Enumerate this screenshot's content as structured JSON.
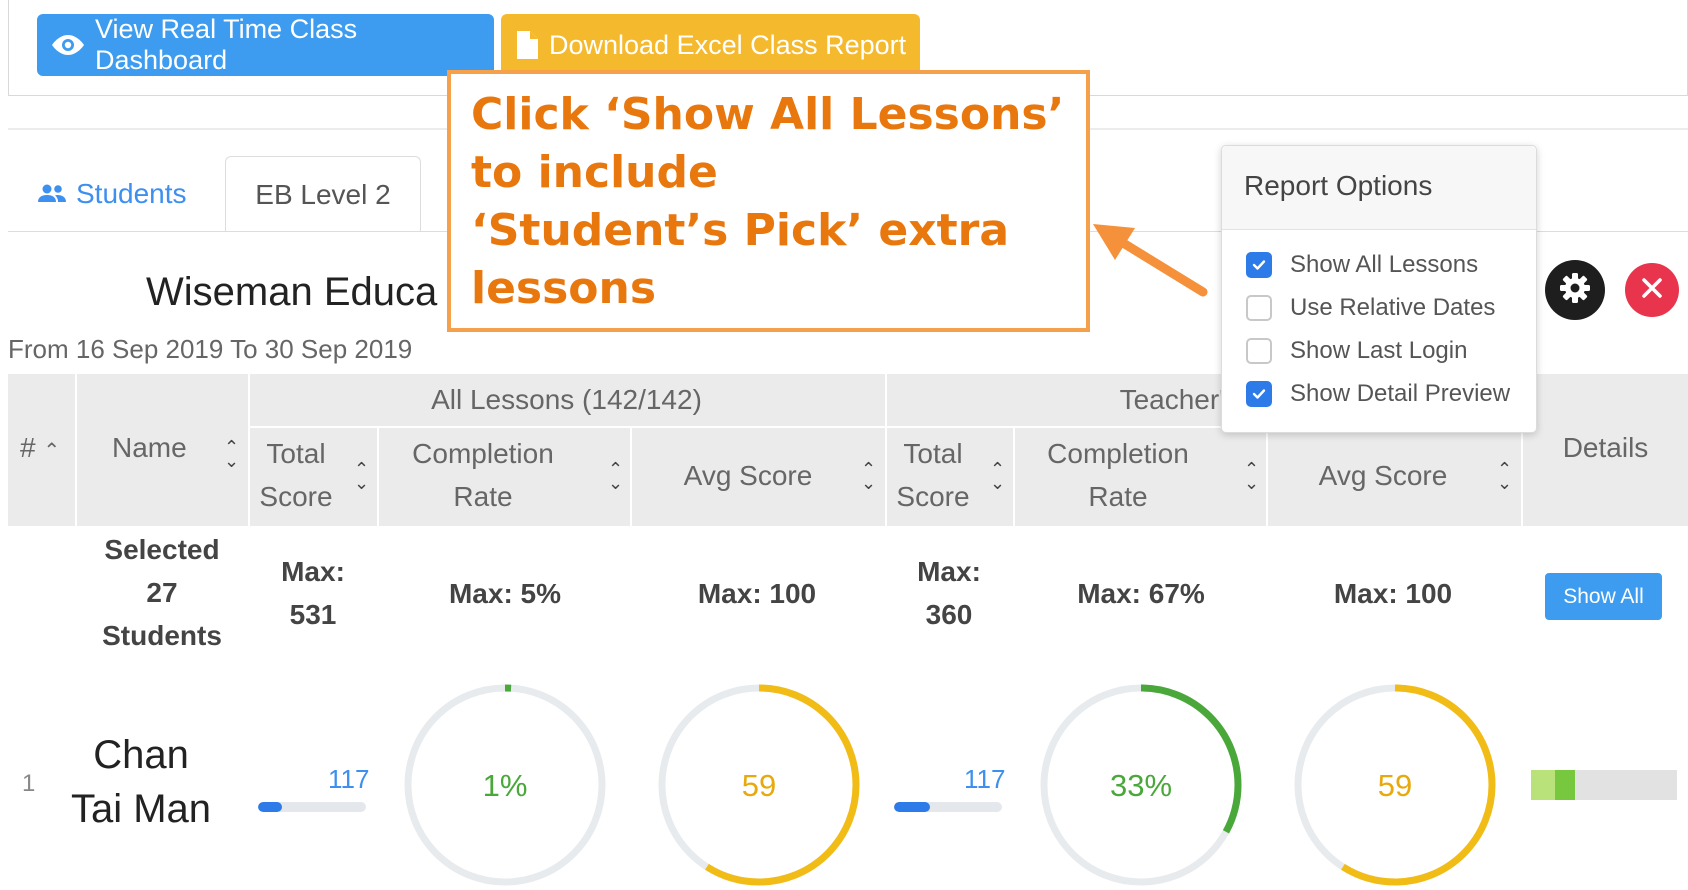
{
  "toolbar": {
    "dashboard_label": "View Real Time Class Dashboard",
    "excel_label": "Download Excel Class Report"
  },
  "tabs": {
    "students": "Students",
    "class": "EB Level 2"
  },
  "school_name": "Wiseman Educa",
  "date_range": "From 16 Sep 2019 To 30 Sep 2019",
  "table": {
    "group_all": "All Lessons (142/142)",
    "group_teacher": "Teacher's P",
    "col_num": "#",
    "col_name": "Name",
    "col_total_score_1": "Total",
    "col_total_score_2": "Score",
    "col_completion_1": "Completion",
    "col_completion_2": "Rate",
    "col_avg": "Avg Score",
    "col_details": "Details"
  },
  "summary": {
    "selected_1": "Selected",
    "selected_2": "27",
    "selected_3": "Students",
    "all_max_label": "Max:",
    "all_total_max": "531",
    "all_completion_max": "Max: 5%",
    "all_avg_max": "Max: 100",
    "teacher_max_label": "Max:",
    "teacher_total_max": "360",
    "teacher_completion_max": "Max: 67%",
    "teacher_avg_max": "Max: 100",
    "show_all_label": "Show All"
  },
  "student": {
    "index": "1",
    "name_line1": "Chan",
    "name_line2": "Tai Man",
    "all_total": "117",
    "all_total_fraction": 0.22,
    "all_completion": "1%",
    "all_completion_value": 0.01,
    "all_avg": "59",
    "all_avg_value": 0.59,
    "teacher_total": "117",
    "teacher_total_fraction": 0.33,
    "teacher_completion": "33%",
    "teacher_completion_value": 0.33,
    "teacher_avg": "59",
    "teacher_avg_value": 0.59
  },
  "report_options": {
    "title": "Report Options",
    "options": [
      {
        "label": "Show All Lessons",
        "checked": true
      },
      {
        "label": "Use Relative Dates",
        "checked": false
      },
      {
        "label": "Show Last Login",
        "checked": false
      },
      {
        "label": "Show Detail Preview",
        "checked": true
      }
    ]
  },
  "callout": {
    "text": "Click ‘Show All Lessons’\nto include\n‘Student’s Pick’ extra\nlessons"
  },
  "colors": {
    "primary": "#3d9cf0",
    "warning": "#f5b92e",
    "green": "#4aa83b",
    "orange_callout": "#e8770e",
    "danger": "#e8354d"
  }
}
